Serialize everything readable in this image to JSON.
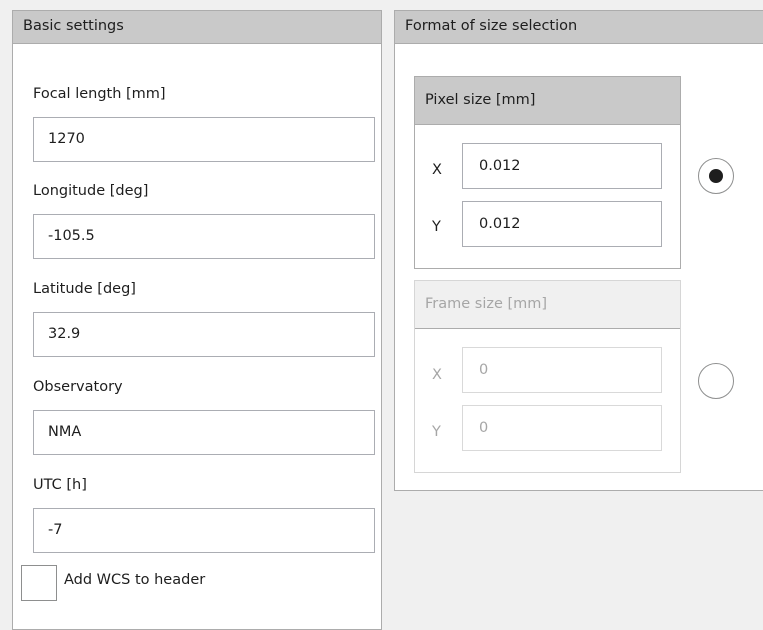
{
  "basic_settings": {
    "title": "Basic settings",
    "focal_length": {
      "label": "Focal length [mm]",
      "value": "1270"
    },
    "longitude": {
      "label": "Longitude [deg]",
      "value": "-105.5"
    },
    "latitude": {
      "label": "Latitude [deg]",
      "value": "32.9"
    },
    "observatory": {
      "label": "Observatory",
      "value": "NMA"
    },
    "utc": {
      "label": "UTC [h]",
      "value": "-7"
    },
    "add_wcs": {
      "label": "Add WCS to header",
      "checked": false
    }
  },
  "format_of_size_selection": {
    "title": "Format of size selection",
    "pixel_size": {
      "title": "Pixel size [mm]",
      "x_label": "X",
      "x_value": "0.012",
      "y_label": "Y",
      "y_value": "0.012",
      "selected": true,
      "enabled": true
    },
    "frame_size": {
      "title": "Frame size [mm]",
      "x_label": "X",
      "x_value": "0",
      "y_label": "Y",
      "y_value": "0",
      "selected": false,
      "enabled": false
    }
  }
}
